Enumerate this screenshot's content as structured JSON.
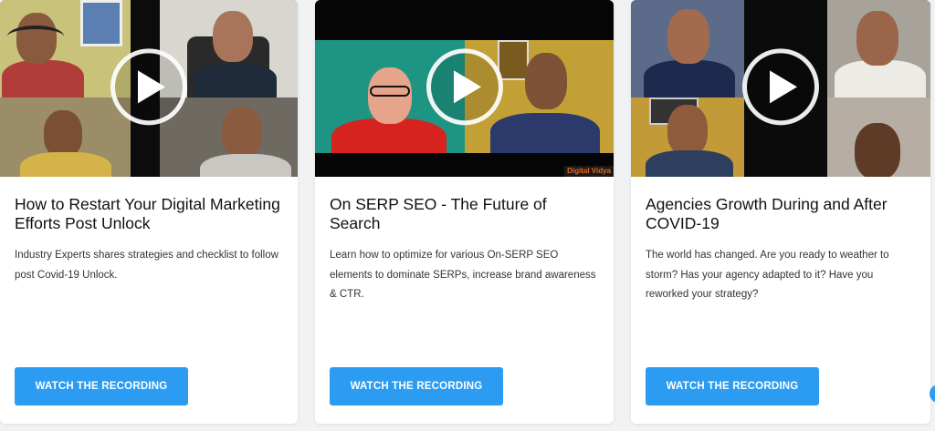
{
  "cards": [
    {
      "title": "How to Restart Your Digital Marketing Efforts Post Unlock",
      "description": "Industry Experts shares strategies and checklist to follow post Covid-19 Unlock.",
      "button_label": "WATCH THE RECORDING"
    },
    {
      "title": "On SERP SEO - The Future of Search",
      "description": "Learn how to optimize for various On-SERP SEO elements to dominate SERPs, increase brand awareness & CTR.",
      "button_label": "WATCH THE RECORDING",
      "thumbnail_brand": "Digital Vidya"
    },
    {
      "title": "Agencies Growth During and After COVID-19",
      "description": "The world has changed. Are you ready to weather to storm? Has your agency adapted to it? Have you reworked your strategy?",
      "button_label": "WATCH THE RECORDING"
    }
  ],
  "colors": {
    "button": "#2b9cf2",
    "card_background": "#ffffff",
    "page_background": "#f1f2f4"
  },
  "icons": [
    "play-icon"
  ]
}
